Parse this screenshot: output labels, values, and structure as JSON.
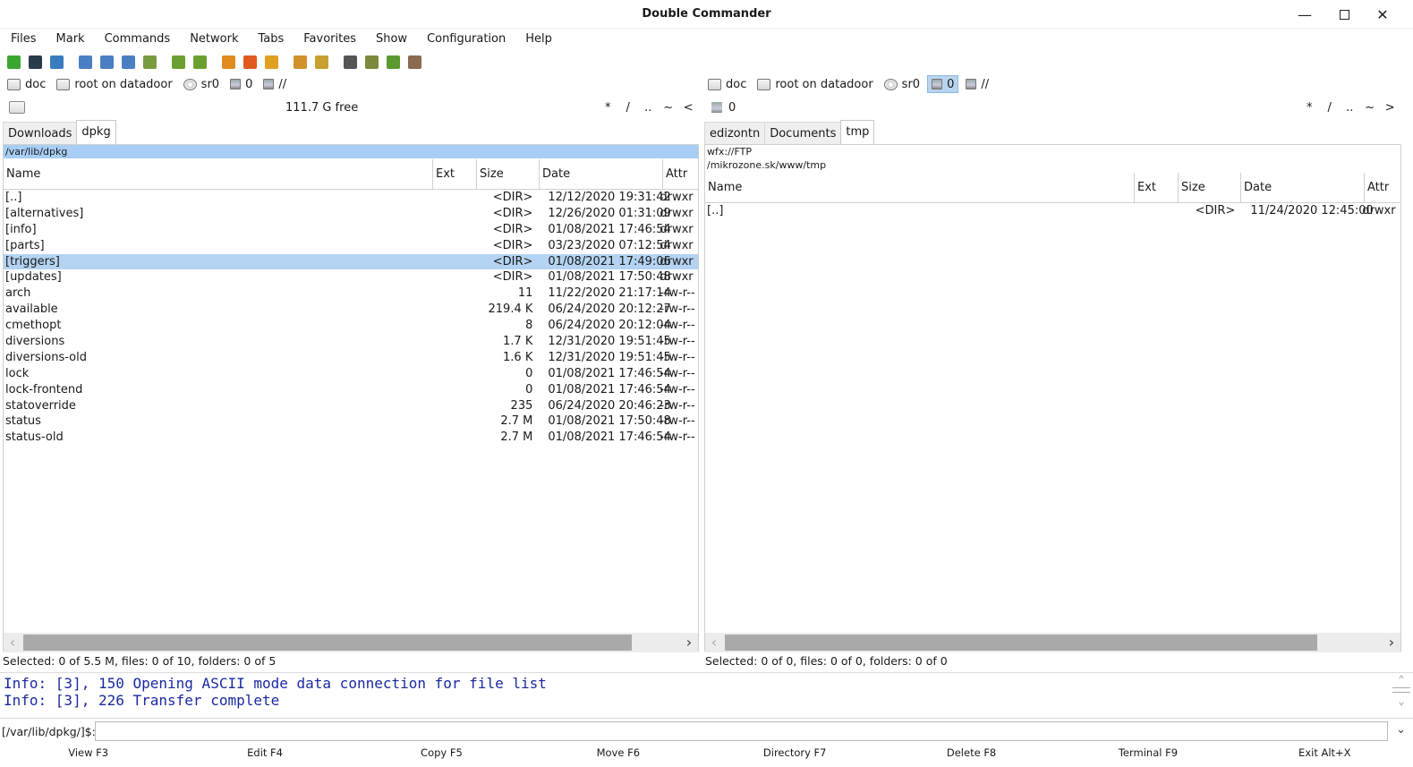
{
  "window": {
    "title": "Double Commander"
  },
  "menu": [
    "Files",
    "Mark",
    "Commands",
    "Network",
    "Tabs",
    "Favorites",
    "Show",
    "Configuration",
    "Help"
  ],
  "toolbar_icons": [
    {
      "name": "refresh-icon",
      "color": "#3aa830"
    },
    {
      "name": "terminal-icon",
      "color": "#2a3a4a"
    },
    {
      "name": "options-icon",
      "color": "#3a7cc0"
    },
    {
      "sep": true
    },
    {
      "name": "brief-view-icon",
      "color": "#4a7fc4"
    },
    {
      "name": "full-view-icon",
      "color": "#4a7fc4"
    },
    {
      "name": "thumbnail-view-icon",
      "color": "#4a7fc4"
    },
    {
      "name": "sync-dirs-icon",
      "color": "#7a9a40"
    },
    {
      "sep": true
    },
    {
      "name": "copy-left-icon",
      "color": "#6ba030"
    },
    {
      "name": "copy-right-icon",
      "color": "#6ba030"
    },
    {
      "sep": true
    },
    {
      "name": "ftp-connect-icon",
      "color": "#e08a20"
    },
    {
      "name": "ftp-disconnect-icon",
      "color": "#e05a20"
    },
    {
      "name": "ftp-new-connection-icon",
      "color": "#e0a020"
    },
    {
      "sep": true
    },
    {
      "name": "pack-files-icon",
      "color": "#d0902a"
    },
    {
      "name": "unpack-files-icon",
      "color": "#c8a030"
    },
    {
      "sep": true
    },
    {
      "name": "search-icon",
      "color": "#555555"
    },
    {
      "name": "multi-rename-icon",
      "color": "#7a8a3a"
    },
    {
      "name": "compare-icon",
      "color": "#5a9a30"
    },
    {
      "name": "copy-names-icon",
      "color": "#8a6a50"
    }
  ],
  "left": {
    "drives": [
      {
        "label": "doc",
        "type": "hdd"
      },
      {
        "label": "root on datadoor",
        "type": "hdd"
      },
      {
        "label": "sr0",
        "type": "cd"
      },
      {
        "label": "0",
        "type": "net"
      },
      {
        "label": "//",
        "type": "net"
      }
    ],
    "free": "111.7 G free",
    "nav": [
      "*",
      "/",
      "..",
      "~",
      "<"
    ],
    "tabs": [
      "Downloads",
      "dpkg"
    ],
    "active_tab": 1,
    "path": "/var/lib/dpkg",
    "columns": [
      "Name",
      "Ext",
      "Size",
      "Date",
      "Attr"
    ],
    "files": [
      {
        "name": "[..]",
        "ext": "",
        "size": "<DIR>",
        "date": "12/12/2020 19:31:42",
        "attr": "drwxr"
      },
      {
        "name": "[alternatives]",
        "ext": "",
        "size": "<DIR>",
        "date": "12/26/2020 01:31:09",
        "attr": "drwxr"
      },
      {
        "name": "[info]",
        "ext": "",
        "size": "<DIR>",
        "date": "01/08/2021 17:46:54",
        "attr": "drwxr"
      },
      {
        "name": "[parts]",
        "ext": "",
        "size": "<DIR>",
        "date": "03/23/2020 07:12:54",
        "attr": "drwxr"
      },
      {
        "name": "[triggers]",
        "ext": "",
        "size": "<DIR>",
        "date": "01/08/2021 17:49:06",
        "attr": "drwxr",
        "selected": true
      },
      {
        "name": "[updates]",
        "ext": "",
        "size": "<DIR>",
        "date": "01/08/2021 17:50:48",
        "attr": "drwxr"
      },
      {
        "name": "arch",
        "ext": "",
        "size": "11",
        "date": "11/22/2020 21:17:14",
        "attr": "-rw-r--"
      },
      {
        "name": "available",
        "ext": "",
        "size": "219.4 K",
        "date": "06/24/2020 20:12:27",
        "attr": "-rw-r--"
      },
      {
        "name": "cmethopt",
        "ext": "",
        "size": "8",
        "date": "06/24/2020 20:12:04",
        "attr": "-rw-r--"
      },
      {
        "name": "diversions",
        "ext": "",
        "size": "1.7 K",
        "date": "12/31/2020 19:51:45",
        "attr": "-rw-r--"
      },
      {
        "name": "diversions-old",
        "ext": "",
        "size": "1.6 K",
        "date": "12/31/2020 19:51:45",
        "attr": "-rw-r--"
      },
      {
        "name": "lock",
        "ext": "",
        "size": "0",
        "date": "01/08/2021 17:46:54",
        "attr": "-rw-r--"
      },
      {
        "name": "lock-frontend",
        "ext": "",
        "size": "0",
        "date": "01/08/2021 17:46:54",
        "attr": "-rw-r--"
      },
      {
        "name": "statoverride",
        "ext": "",
        "size": "235",
        "date": "06/24/2020 20:46:23",
        "attr": "-rw-r--"
      },
      {
        "name": "status",
        "ext": "",
        "size": "2.7 M",
        "date": "01/08/2021 17:50:48",
        "attr": "-rw-r--"
      },
      {
        "name": "status-old",
        "ext": "",
        "size": "2.7 M",
        "date": "01/08/2021 17:46:54",
        "attr": "-rw-r--"
      }
    ],
    "status": "Selected: 0 of 5.5 M, files: 0 of 10, folders: 0 of 5"
  },
  "right": {
    "drives": [
      {
        "label": "doc",
        "type": "hdd"
      },
      {
        "label": "root on datadoor",
        "type": "hdd"
      },
      {
        "label": "sr0",
        "type": "cd"
      },
      {
        "label": "0",
        "type": "net",
        "active": true
      },
      {
        "label": "//",
        "type": "net"
      }
    ],
    "free": "0",
    "nav": [
      "*",
      "/",
      "..",
      "~",
      ">"
    ],
    "tabs": [
      "edizontn",
      "Documents",
      "tmp"
    ],
    "active_tab": 2,
    "path_line1": "wfx://FTP",
    "path_line2": "/mikrozone.sk/www/tmp",
    "columns": [
      "Name",
      "Ext",
      "Size",
      "Date",
      "Attr"
    ],
    "files": [
      {
        "name": "[..]",
        "ext": "",
        "size": "<DIR>",
        "date": "11/24/2020 12:45:00",
        "attr": "drwxr"
      }
    ],
    "status": "Selected: 0 of 0, files: 0 of 0, folders: 0 of 0"
  },
  "log": [
    "Info: [3], 150 Opening ASCII mode data connection for file list",
    "Info: [3], 226 Transfer complete"
  ],
  "cmd_prompt": "[/var/lib/dpkg/]$:",
  "fkeys": [
    "View F3",
    "Edit F4",
    "Copy F5",
    "Move F6",
    "Directory F7",
    "Delete F8",
    "Terminal F9",
    "Exit Alt+X"
  ],
  "colors": {
    "selection": "#b4d3f2",
    "path_highlight": "#a8cef5",
    "log_text": "#1a2aa0"
  }
}
